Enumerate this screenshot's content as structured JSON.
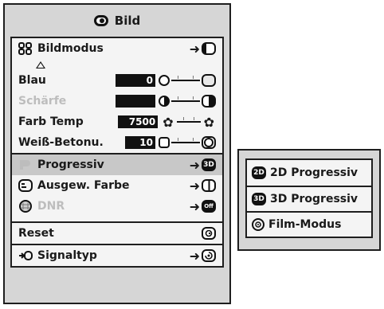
{
  "title": "Bild",
  "menu": [
    {
      "label": "Bildmodus",
      "icon": "picture-mode-icon",
      "value_icon": "display-mode-icon"
    },
    {
      "label": "Blau",
      "value": "0"
    },
    {
      "label": "Schärfe",
      "disabled": true
    },
    {
      "label": "Farb Temp",
      "value": "7500"
    },
    {
      "label": "Weiß-Betonu.",
      "value": "10"
    },
    {
      "label": "Progressiv",
      "value_icon": "3D"
    },
    {
      "label": "Ausgew. Farbe",
      "value_icon": "color-icon"
    },
    {
      "label": "DNR",
      "disabled": true,
      "value_icon": "Off"
    },
    {
      "label": "Reset"
    },
    {
      "label": "Signaltyp"
    }
  ],
  "submenu": {
    "items": [
      {
        "badge": "2D",
        "label": "2D Progressiv"
      },
      {
        "badge": "3D",
        "label": "3D Progressiv"
      },
      {
        "badge": "",
        "label": "Film-Modus"
      }
    ]
  },
  "arrow": "➜",
  "colors": {
    "panel_bg": "#d6d6d6",
    "inner_bg": "#f4f4f4",
    "border": "#1e1e1e",
    "selected": "#c8c8c8",
    "disabled_text": "#bdbdbd"
  }
}
